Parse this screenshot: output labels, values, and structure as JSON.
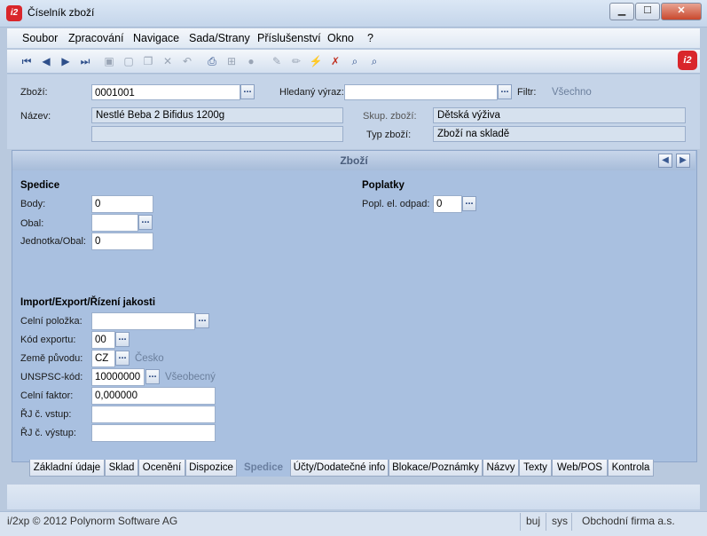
{
  "window": {
    "title": "Číselník zboží",
    "app_logo": "i2",
    "buttons": {
      "minimize": "▁",
      "maximize": "☐",
      "close": "✕"
    }
  },
  "menu": [
    "Soubor",
    "Zpracování",
    "Navigace",
    "Sada/Strany",
    "Příslušenství",
    "Okno",
    "?"
  ],
  "toolbar_icons": [
    "first-record-icon",
    "previous-record-icon",
    "next-record-icon",
    "last-record-icon",
    "save-icon",
    "new-icon",
    "copy-icon",
    "delete-icon",
    "undo-icon",
    "print-icon",
    "structure-icon",
    "disc-icon",
    "edit-icon",
    "pencil-icon",
    "filter-icon",
    "clear-filter-icon",
    "search-icon",
    "search-advanced-icon"
  ],
  "header": {
    "item_label": "Zboží:",
    "item_value": "0001001",
    "search_label": "Hledaný výraz:",
    "search_value": "",
    "filter_label": "Filtr:",
    "filter_value": "Všechno",
    "name_label": "Název:",
    "name_value": "Nestlé Beba 2 Bifidus 1200g",
    "name_value2": "",
    "group_label": "Skup. zboží:",
    "group_value": "Dětská výživa",
    "type_label": "Typ zboží:",
    "type_value": "Zboží na skladě"
  },
  "section": {
    "title": "Zboží"
  },
  "spedice": {
    "title": "Spedice",
    "points_label": "Body:",
    "points_value": "0",
    "package_label": "Obal:",
    "package_value": "",
    "unit_label": "Jednotka/Obal:",
    "unit_value": "0"
  },
  "fees": {
    "title": "Poplatky",
    "waste_label": "Popl. el. odpad:",
    "waste_value": "0"
  },
  "import": {
    "title": "Import/Export/Řízení jakosti",
    "customs_label": "Celní položka:",
    "customs_value": "",
    "export_label": "Kód exportu:",
    "export_value": "00",
    "origin_label": "Země původu:",
    "origin_value": "CZ",
    "origin_name": "Česko",
    "unspsc_label": "UNSPSC-kód:",
    "unspsc_value": "10000000",
    "unspsc_name": "Všeobecný",
    "factor_label": "Celní faktor:",
    "factor_value": "0,000000",
    "in_label": "ŘJ č. vstup:",
    "in_value": "",
    "out_label": "ŘJ č. výstup:",
    "out_value": ""
  },
  "tabs": [
    "Základní údaje",
    "Sklad",
    "Ocenění",
    "Dispozice",
    "Spedice",
    "Účty/Dodatečné info",
    "Blokace/Poznámky",
    "Názvy",
    "Texty",
    "Web/POS",
    "Kontrola"
  ],
  "status": {
    "copyright": "i/2xp © 2012 Polynorm Software AG",
    "user": "buj",
    "db": "sys",
    "company": "Obchodní firma a.s."
  }
}
